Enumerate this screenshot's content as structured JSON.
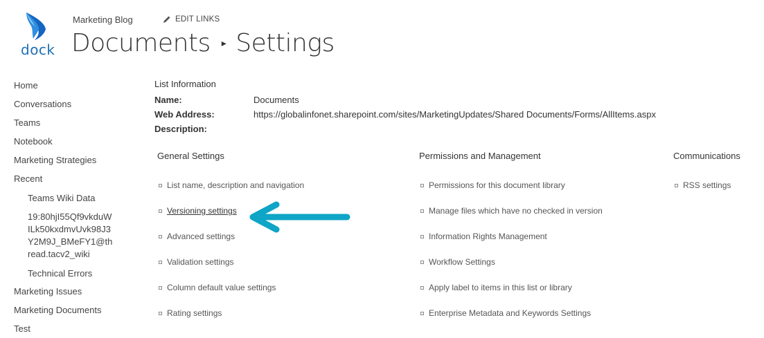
{
  "brand": {
    "logo_text": "dock",
    "accent": "#1f6fb7",
    "arrow_color": "#0ea5c6"
  },
  "header": {
    "site_title": "Marketing Blog",
    "edit_links_label": "EDIT LINKS",
    "breadcrumb_parent": "Documents",
    "breadcrumb_current": "Settings"
  },
  "nav": {
    "items": [
      "Home",
      "Conversations",
      "Teams",
      "Notebook",
      "Marketing Strategies",
      "Recent"
    ],
    "recent_items": [
      "Teams Wiki Data",
      "19:80hjI55Qf9vkduWILk50kxdmvUvk98J3Y2M9J_BMeFY1@thread.tacv2_wiki",
      "Technical Errors"
    ],
    "items_after": [
      "Marketing Issues",
      "Marketing Documents",
      "Test"
    ]
  },
  "list_info": {
    "header": "List Information",
    "name_label": "Name:",
    "name_value": "Documents",
    "web_label": "Web Address:",
    "web_value": "https://globalinfonet.sharepoint.com/sites/MarketingUpdates/Shared Documents/Forms/AllItems.aspx",
    "desc_label": "Description:"
  },
  "general": {
    "header": "General Settings",
    "links": [
      "List name, description and navigation",
      "Versioning settings",
      "Advanced settings",
      "Validation settings",
      "Column default value settings",
      "Rating settings"
    ]
  },
  "permissions": {
    "header": "Permissions and Management",
    "links": [
      "Permissions for this document library",
      "Manage files which have no checked in version",
      "Information Rights Management",
      "Workflow Settings",
      "Apply label to items in this list or library",
      "Enterprise Metadata and Keywords Settings"
    ]
  },
  "communications": {
    "header": "Communications",
    "links": [
      "RSS settings"
    ]
  }
}
